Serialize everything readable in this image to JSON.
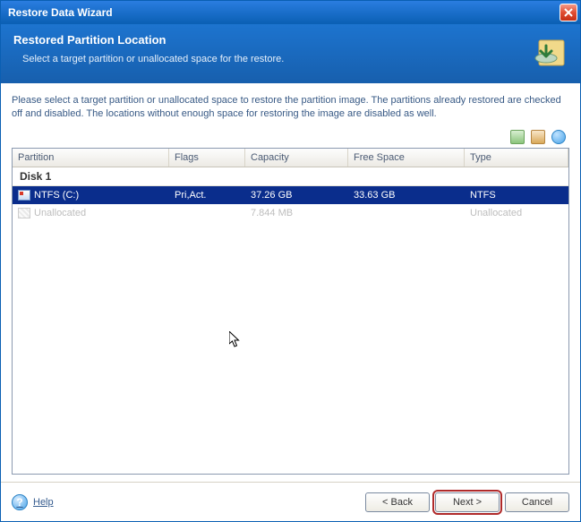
{
  "window": {
    "title": "Restore Data Wizard"
  },
  "header": {
    "title": "Restored Partition Location",
    "subtitle": "Select a target partition or unallocated space for the restore."
  },
  "instructions": "Please select a target partition or unallocated space to restore the partition image. The partitions already restored are checked off and disabled. The locations without enough space for restoring the image are disabled as well.",
  "columns": {
    "partition": "Partition",
    "flags": "Flags",
    "capacity": "Capacity",
    "free": "Free Space",
    "type": "Type"
  },
  "group": {
    "label": "Disk 1"
  },
  "rows": [
    {
      "partition": "NTFS (C:)",
      "flags": "Pri,Act.",
      "capacity": "37.26 GB",
      "free": "33.63 GB",
      "type": "NTFS",
      "selected": true,
      "disabled": false,
      "icon": "ntfs"
    },
    {
      "partition": "Unallocated",
      "flags": "",
      "capacity": "7.844 MB",
      "free": "",
      "type": "Unallocated",
      "selected": false,
      "disabled": true,
      "icon": "unalloc"
    }
  ],
  "footer": {
    "help": "Help",
    "back": "< Back",
    "next": "Next >",
    "cancel": "Cancel"
  }
}
